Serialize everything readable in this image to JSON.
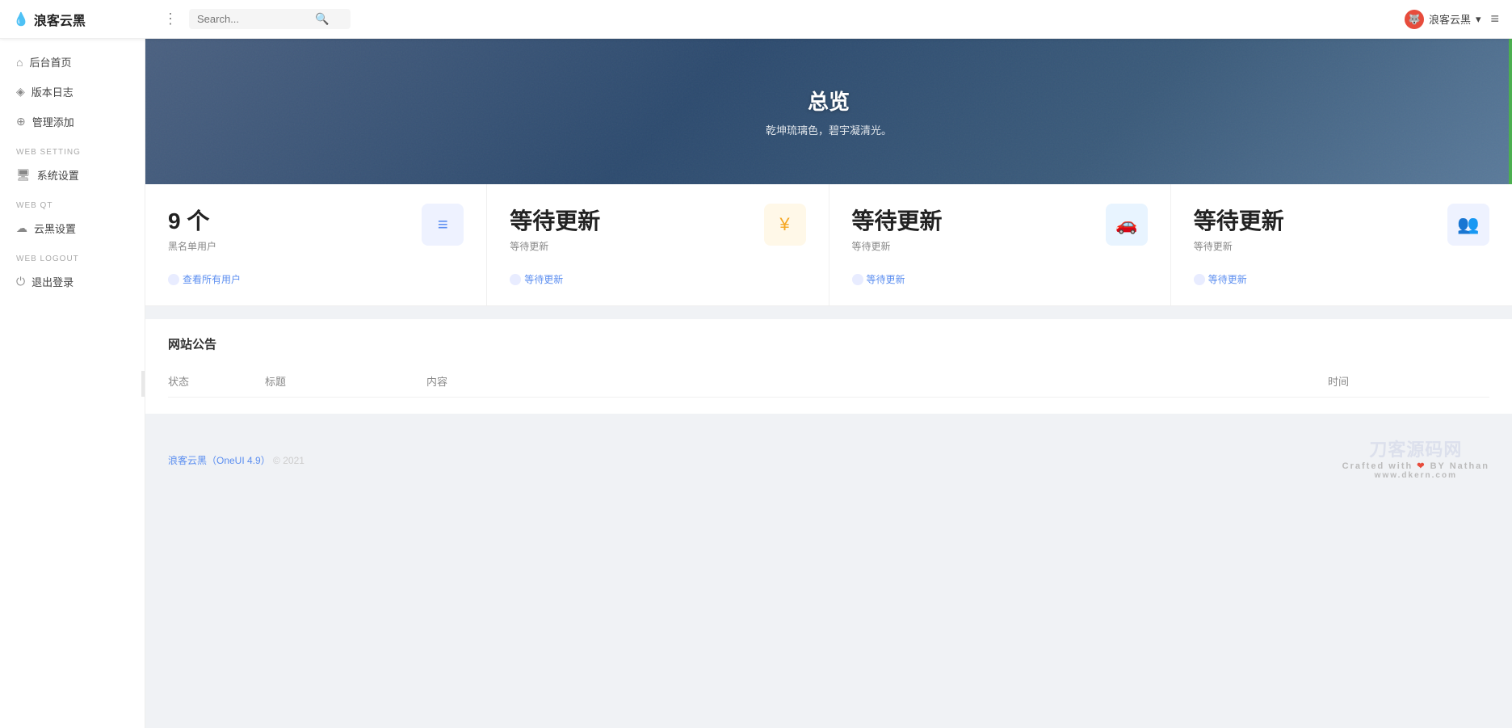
{
  "header": {
    "logo": "浪客云黑",
    "logo_icon": "💧",
    "search_placeholder": "Search...",
    "user_name": "浪客云黑",
    "user_dropdown": "▾",
    "hamburger": "≡"
  },
  "sidebar": {
    "collapse_icon": "‹",
    "items": [
      {
        "id": "dashboard",
        "label": "后台首页",
        "icon": "⌂"
      },
      {
        "id": "changelog",
        "label": "版本日志",
        "icon": "◈"
      },
      {
        "id": "add-admin",
        "label": "管理添加",
        "icon": "⊕"
      }
    ],
    "sections": [
      {
        "label": "WEB SETTING",
        "items": [
          {
            "id": "system-settings",
            "label": "系统设置",
            "icon": "▭"
          }
        ]
      },
      {
        "label": "WEB QT",
        "items": [
          {
            "id": "cloud-settings",
            "label": "云黑设置",
            "icon": "⊡"
          }
        ]
      },
      {
        "label": "WEB LOGOUT",
        "items": [
          {
            "id": "logout",
            "label": "退出登录",
            "icon": "⏻"
          }
        ]
      }
    ]
  },
  "hero": {
    "title": "总览",
    "subtitle": "乾坤琉璃色，碧宇凝清光。"
  },
  "stats": [
    {
      "value": "9 个",
      "label": "黑名单用户",
      "link_text": "查看所有用户",
      "icon": "≡",
      "icon_class": "indigo"
    },
    {
      "value": "等待更新",
      "label": "等待更新",
      "link_text": "等待更新",
      "icon": "¥",
      "icon_class": "yellow"
    },
    {
      "value": "等待更新",
      "label": "等待更新",
      "link_text": "等待更新",
      "icon": "🚗",
      "icon_class": "blue2"
    },
    {
      "value": "等待更新",
      "label": "等待更新",
      "link_text": "等待更新",
      "icon": "👥",
      "icon_class": "indigo"
    }
  ],
  "announce": {
    "title": "网站公告",
    "columns": [
      "状态",
      "标题",
      "内容",
      "时间"
    ],
    "rows": []
  },
  "footer": {
    "brand": "浪客云黑（OneUI 4.9）",
    "year": "© 2021",
    "watermark": "刀客源码网",
    "crafted": "Crafted with",
    "author": "BY Nathan",
    "site": "www.dkern.com"
  }
}
